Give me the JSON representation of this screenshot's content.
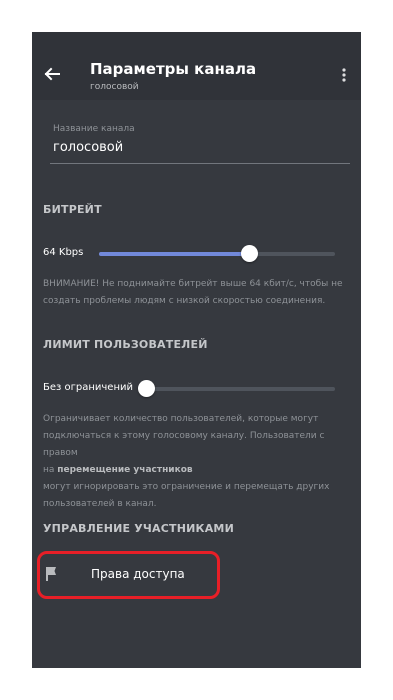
{
  "header": {
    "title": "Параметры канала",
    "subtitle": "голосовой",
    "back_icon": "arrow-left-icon",
    "menu_icon": "more-vertical-icon"
  },
  "channel_name": {
    "label": "Название канала",
    "value": "голосовой"
  },
  "bitrate": {
    "section_title": "БИТРЕЙТ",
    "value_label": "64 Kbps",
    "slider_fraction": 0.63,
    "warning_line1": "ВНИМАНИЕ! Не поднимайте битрейт выше 64 кбит/с, чтобы не",
    "warning_line2": "создать проблемы людям с низкой скоростью соединения."
  },
  "user_limit": {
    "section_title": "ЛИМИТ ПОЛЬЗОВАТЕЛЕЙ",
    "value_label": "Без ограничений",
    "slider_fraction": 0.0,
    "help_line1": "Ограничивает количество пользователей, которые могут",
    "help_line2": "подключаться к этому голосовому каналу. Пользователи с правом",
    "help_line3_prefix": "на ",
    "help_line3_bold": "перемещение участников",
    "help_line4": "могут игнорировать это ограничение и перемещать других",
    "help_line5": "пользователей в канал."
  },
  "members": {
    "section_title": "УПРАВЛЕНИЕ УЧАСТНИКАМИ",
    "access_label": "Права доступа",
    "access_icon": "flag-icon"
  },
  "colors": {
    "background": "#36393f",
    "header": "#303339",
    "accent": "#7289da",
    "highlight": "#e81f27"
  }
}
